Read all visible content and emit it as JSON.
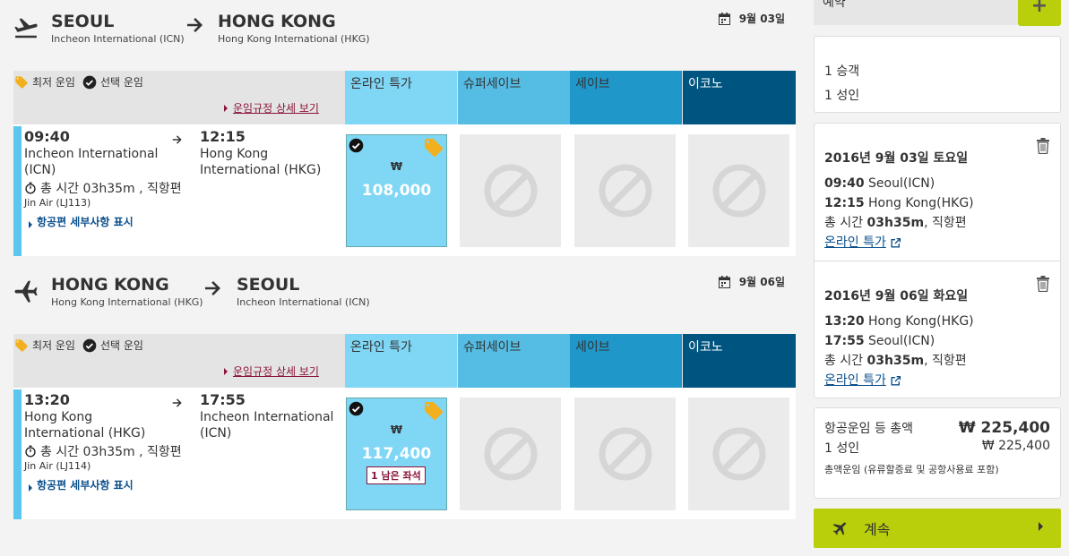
{
  "outbound": {
    "origin_city": "SEOUL",
    "origin_airport": "Incheon International (ICN)",
    "dest_city": "HONG KONG",
    "dest_airport": "Hong Kong International (HKG)",
    "date": "9월 03일",
    "legend_lowest": "최저 운임",
    "legend_selected": "선택 운임",
    "rules_link": "운임규정 상세 보기",
    "columns": [
      "온라인 특가",
      "슈퍼세이브",
      "세이브",
      "이코노"
    ],
    "flight": {
      "dep_time": "09:40",
      "dep_airport": "Incheon International (ICN)",
      "arr_time": "12:15",
      "arr_airport": "Hong Kong International (HKG)",
      "duration": "총 시간 03h35m , 직항편",
      "carrier": "Jin Air (LJ113)",
      "details_link": "항공편 세부사항 표시",
      "currency": "₩",
      "price": "108,000"
    }
  },
  "inbound": {
    "origin_city": "HONG KONG",
    "origin_airport": "Hong Kong International (HKG)",
    "dest_city": "SEOUL",
    "dest_airport": "Incheon International (ICN)",
    "date": "9월 06일",
    "legend_lowest": "최저 운임",
    "legend_selected": "선택 운임",
    "rules_link": "운임규정 상세 보기",
    "columns": [
      "온라인 특가",
      "슈퍼세이브",
      "세이브",
      "이코노"
    ],
    "flight": {
      "dep_time": "13:20",
      "dep_airport": "Hong Kong International (HKG)",
      "arr_time": "17:55",
      "arr_airport": "Incheon International (ICN)",
      "duration": "총 시간 03h35m , 직항편",
      "carrier": "Jin Air (LJ114)",
      "details_link": "항공편 세부사항 표시",
      "currency": "₩",
      "price": "117,400",
      "seats_left": "1 남은 좌석"
    }
  },
  "sidebar": {
    "top_label": "예약",
    "plus": "+",
    "passengers": [
      "1 승객",
      "1 성인"
    ],
    "segments": [
      {
        "date": "2016년 9월 03일 토요일",
        "dep_time": "09:40",
        "dep_place": "Seoul(ICN)",
        "arr_time": "12:15",
        "arr_place": "Hong Kong(HKG)",
        "duration_label": "총 시간",
        "duration": "03h35m",
        "direct": ", 직항편",
        "fare": "온라인 특가"
      },
      {
        "date": "2016년 9월 06일 화요일",
        "dep_time": "13:20",
        "dep_place": "Hong Kong(HKG)",
        "arr_time": "17:55",
        "arr_place": "Seoul(ICN)",
        "duration_label": "총 시간",
        "duration": "03h35m",
        "direct": ", 직항편",
        "fare": "온라인 특가"
      }
    ],
    "total_label": "항공운임 등 총액",
    "total_amount": "₩ 225,400",
    "adult_label": "1 성인",
    "adult_amount": "₩ 225,400",
    "total_note": "총액운임 (유류할증료 및 공항사용료 포함)",
    "continue": "계속"
  },
  "colors": {
    "online_special": "#7fd6f5",
    "super_save": "#55bde4",
    "save": "#1f97c9",
    "economy": "#005580",
    "continue_btn": "#b9cf0c",
    "link": "#8a1538"
  }
}
